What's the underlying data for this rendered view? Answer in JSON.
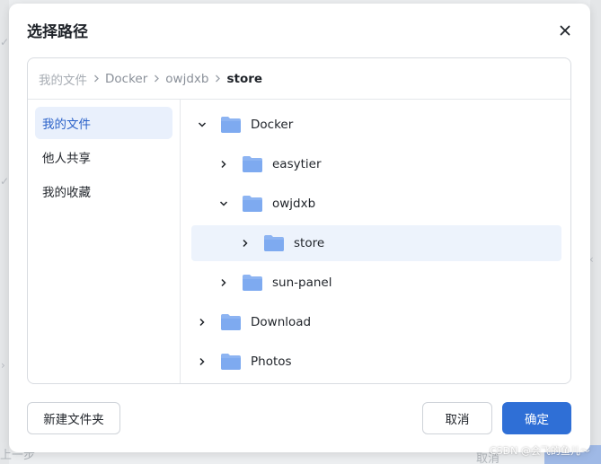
{
  "background": {
    "prev_step": "上一步",
    "cancel": "取消"
  },
  "modal": {
    "title": "选择路径",
    "breadcrumb": [
      "我的文件",
      "Docker",
      "owjdxb",
      "store"
    ],
    "sidebar": [
      {
        "label": "我的文件",
        "active": true
      },
      {
        "label": "他人共享",
        "active": false
      },
      {
        "label": "我的收藏",
        "active": false
      }
    ],
    "tree": [
      {
        "label": "Docker",
        "depth": 0,
        "expanded": true,
        "selected": false
      },
      {
        "label": "easytier",
        "depth": 1,
        "expanded": false,
        "selected": false
      },
      {
        "label": "owjdxb",
        "depth": 1,
        "expanded": true,
        "selected": false
      },
      {
        "label": "store",
        "depth": 2,
        "expanded": false,
        "selected": true
      },
      {
        "label": "sun-panel",
        "depth": 1,
        "expanded": false,
        "selected": false
      },
      {
        "label": "Download",
        "depth": 0,
        "expanded": false,
        "selected": false
      },
      {
        "label": "Photos",
        "depth": 0,
        "expanded": false,
        "selected": false
      }
    ],
    "buttons": {
      "new_folder": "新建文件夹",
      "cancel": "取消",
      "confirm": "确定"
    }
  },
  "watermark": "CSDN @会飞的鱼儿～",
  "colors": {
    "accent": "#2f6fd6",
    "selected_bg": "#edf3fc",
    "folder": "#7eaaf0"
  }
}
